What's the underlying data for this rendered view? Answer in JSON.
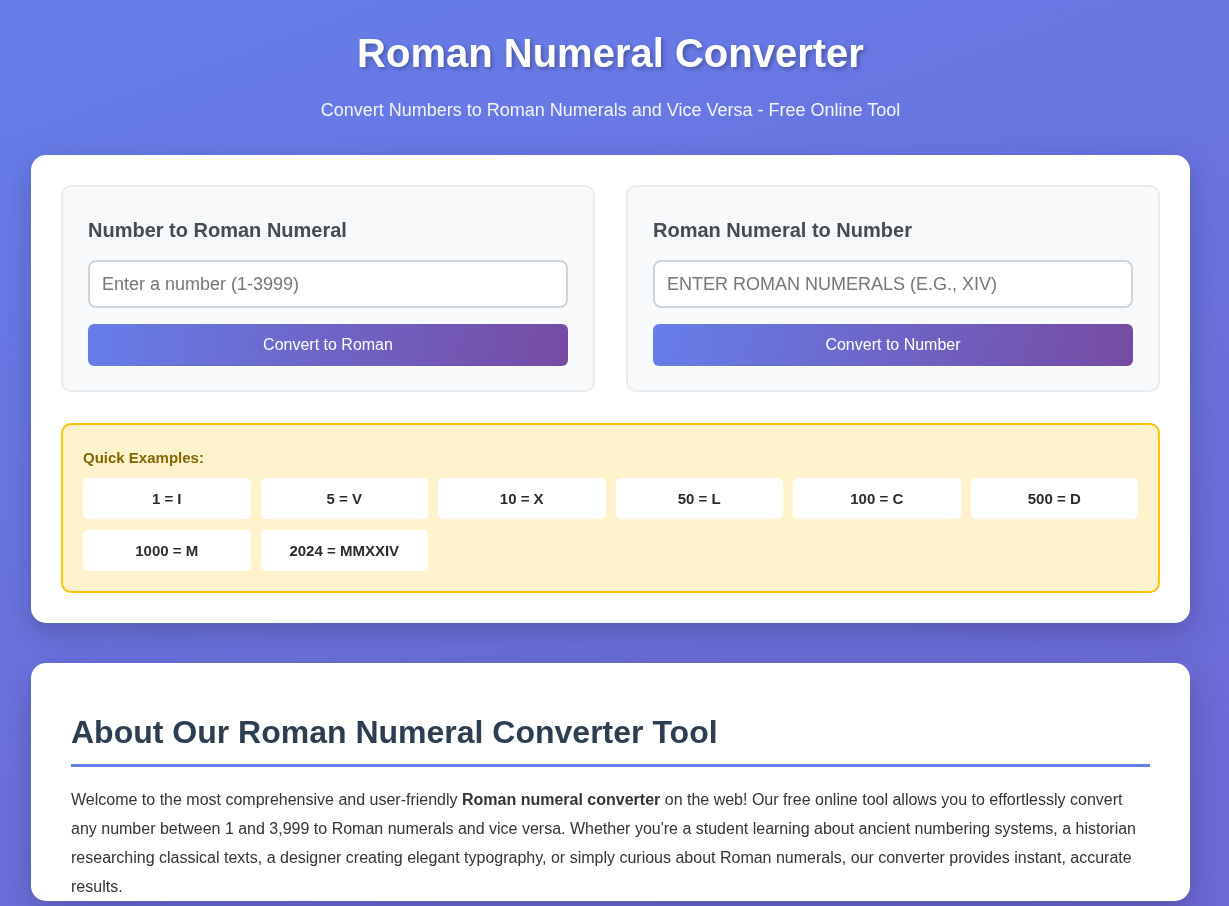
{
  "header": {
    "title": "Roman Numeral Converter",
    "subtitle": "Convert Numbers to Roman Numerals and Vice Versa - Free Online Tool"
  },
  "converters": [
    {
      "heading": "Number to Roman Numeral",
      "placeholder": "Enter a number (1-3999)",
      "button": "Convert to Roman"
    },
    {
      "heading": "Roman Numeral to Number",
      "placeholder": "ENTER ROMAN NUMERALS (E.G., XIV)",
      "button": "Convert to Number"
    }
  ],
  "examples": {
    "title": "Quick Examples:",
    "items": [
      "1 = I",
      "5 = V",
      "10 = X",
      "50 = L",
      "100 = C",
      "500 = D",
      "1000 = M",
      "2024 = MMXXIV"
    ]
  },
  "about": {
    "heading": "About Our Roman Numeral Converter Tool",
    "paragraph": "Welcome to the most comprehensive and user-friendly **Roman numeral converter** on the web! Our free online tool allows you to effortlessly convert any number between 1 and 3,999 to Roman numerals and vice versa. Whether you're a student learning about ancient numbering systems, a historian researching classical texts, a designer creating elegant typography, or simply curious about Roman numerals, our converter provides instant, accurate results."
  }
}
